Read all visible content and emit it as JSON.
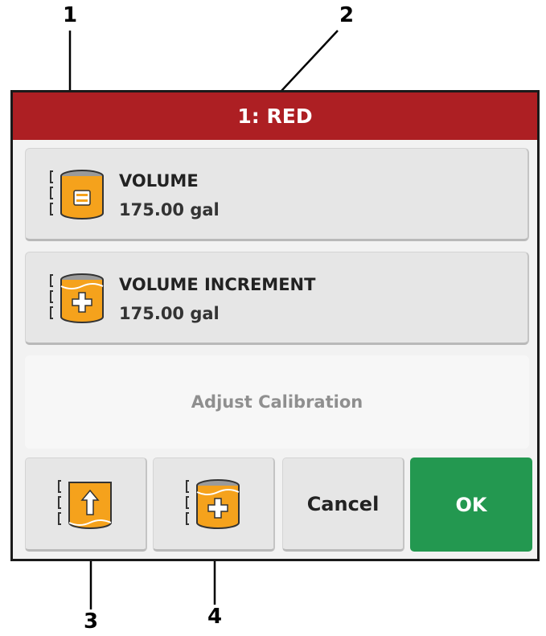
{
  "callouts": [
    "1",
    "2",
    "3",
    "4"
  ],
  "dialog": {
    "title": "1: RED",
    "volume": {
      "label": "VOLUME",
      "value": "175.00 gal"
    },
    "volume_increment": {
      "label": "VOLUME INCREMENT",
      "value": "175.00 gal"
    },
    "adjust_calibration": "Adjust Calibration",
    "buttons": {
      "cancel": "Cancel",
      "ok": "OK"
    }
  },
  "colors": {
    "title_bar": "#ad1f23",
    "ok_button": "#239850",
    "tank_fill": "#f5a21c",
    "disabled_text": "#8f8f8f"
  },
  "icons": [
    "tank-equals-icon",
    "tank-plus-icon",
    "tank-fill-icon",
    "tank-plus-icon"
  ]
}
